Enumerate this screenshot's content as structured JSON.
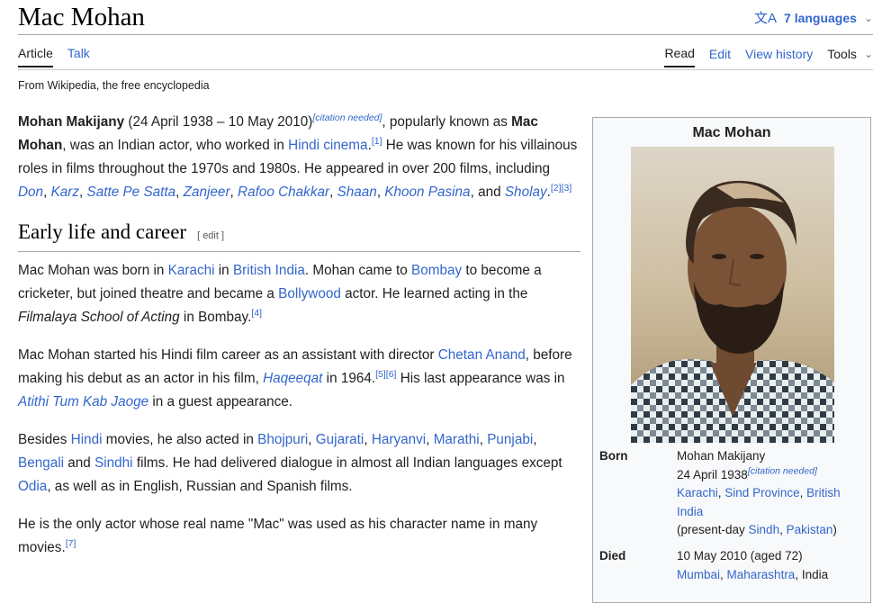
{
  "page": {
    "title": "Mac Mohan",
    "languages_label": "7 languages",
    "tagline": "From Wikipedia, the free encyclopedia"
  },
  "tabs": {
    "article": "Article",
    "talk": "Talk",
    "read": "Read",
    "edit": "Edit",
    "view_history": "View history",
    "tools": "Tools"
  },
  "intro": {
    "name_bold": "Mohan Makijany",
    "dates": " (24 April 1938 – 10 May 2010)",
    "cite_needed": "[citation needed]",
    "t1": ", popularly known as ",
    "alias_bold": "Mac Mohan",
    "t2": ", was an Indian actor, who worked in ",
    "hindi_cinema": "Hindi cinema",
    "ref1": "[1]",
    "t3": " He was known for his villainous roles in films throughout the 1970s and 1980s. He appeared in over 200 films, including ",
    "films": [
      "Don",
      "Karz",
      "Satte Pe Satta",
      "Zanjeer",
      "Rafoo Chakkar",
      "Shaan",
      "Khoon Pasina"
    ],
    "and": ", and ",
    "sholay": "Sholay",
    "ref23": "[2][3]"
  },
  "section": {
    "heading": "Early life and career",
    "edit_label": "[ edit ]"
  },
  "para1": {
    "t1": "Mac Mohan was born in ",
    "karachi": "Karachi",
    "in": " in ",
    "british_india": "British India",
    "t2": ". Mohan came to ",
    "bombay": "Bombay",
    "t3": " to become a cricketer, but joined theatre and became a ",
    "bollywood": "Bollywood",
    "t4": " actor. He learned acting in the ",
    "school": "Filmalaya School of Acting",
    "t5": " in Bombay.",
    "ref4": "[4]"
  },
  "para2": {
    "t1": "Mac Mohan started his Hindi film career as an assistant with director ",
    "chetan": "Chetan Anand",
    "t2": ", before making his debut as an actor in his film, ",
    "haqeeqat": "Haqeeqat",
    "t3": " in 1964.",
    "ref56": "[5][6]",
    "t4": " His last appearance was in ",
    "atithi": "Atithi Tum Kab Jaoge",
    "t5": " in a guest appearance."
  },
  "para3": {
    "t1": "Besides ",
    "hindi": "Hindi",
    "t2": " movies, he also acted in ",
    "bhojpuri": "Bhojpuri",
    "gujarati": "Gujarati",
    "haryanvi": "Haryanvi",
    "marathi": "Marathi",
    "punjabi": "Punjabi",
    "bengali": "Bengali",
    "and": " and ",
    "sindhi": "Sindhi",
    "t3": " films. He had delivered dialogue in almost all Indian languages except ",
    "odia": "Odia",
    "t4": ", as well as in English, Russian and Spanish films."
  },
  "para4": {
    "t1": "He is the only actor whose real name \"Mac\" was used as his character name in many movies.",
    "ref7": "[7]"
  },
  "infobox": {
    "title": "Mac Mohan",
    "born_label": "Born",
    "born_name": "Mohan Makijany",
    "born_date": "24 April 1938",
    "born_cite": "[citation needed]",
    "born_place": [
      "Karachi",
      "Sind Province",
      "British India"
    ],
    "present_day_prefix": "(present-day ",
    "present_day": [
      "Sindh",
      "Pakistan"
    ],
    "present_day_suffix": ")",
    "died_label": "Died",
    "died_date": "10 May 2010 (aged 72)",
    "died_place": [
      "Mumbai",
      "Maharashtra"
    ],
    "died_country": ", India"
  }
}
